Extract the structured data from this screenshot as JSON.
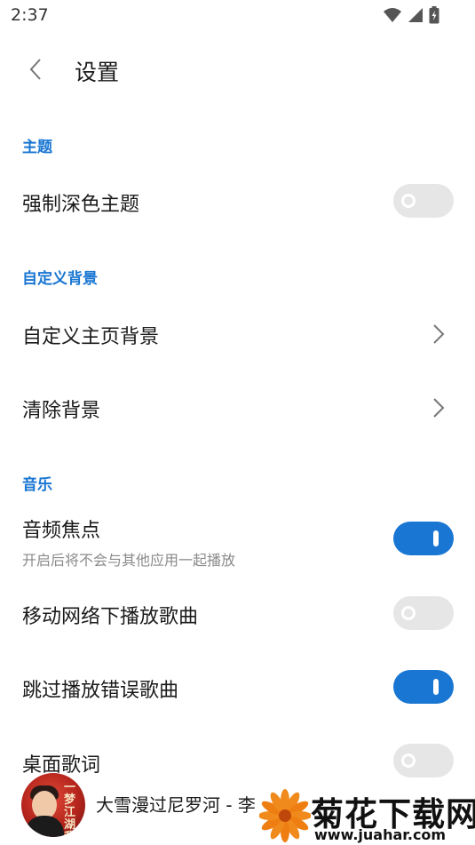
{
  "status_bar": {
    "time": "2:37",
    "icons": [
      "wifi-icon",
      "cell-signal-icon",
      "battery-charging-icon"
    ]
  },
  "app_bar": {
    "back_icon": "chevron-left-icon",
    "title": "设置"
  },
  "sections": [
    {
      "header": "主题",
      "items": [
        {
          "label": "强制深色主题",
          "control": "switch",
          "on": false
        }
      ]
    },
    {
      "header": "自定义背景",
      "items": [
        {
          "label": "自定义主页背景",
          "control": "chevron"
        },
        {
          "label": "清除背景",
          "control": "chevron"
        }
      ]
    },
    {
      "header": "音乐",
      "items": [
        {
          "label": "音频焦点",
          "subtitle": "开启后将不会与其他应用一起播放",
          "control": "switch",
          "on": true
        },
        {
          "label": "移动网络下播放歌曲",
          "control": "switch",
          "on": false
        },
        {
          "label": "跳过播放错误歌曲",
          "control": "switch",
          "on": true
        },
        {
          "label": "桌面歌词",
          "control": "switch",
          "on": false
        }
      ]
    }
  ],
  "mini_player": {
    "album_art_text": "一梦江湖 我是江湖",
    "song_title": "大雪漫过尼罗河 - 李"
  },
  "watermark": {
    "text": "菊花下载网",
    "url": "www.juahar.com",
    "icon": "chrysanthemum-logo"
  },
  "colors": {
    "accent": "#1976d2",
    "switch_off": "#e6e6e6",
    "subtitle": "#8a8a8a"
  }
}
